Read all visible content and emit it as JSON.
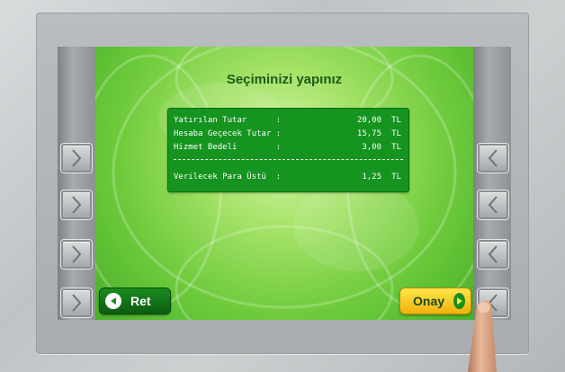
{
  "screen": {
    "title": "Seçiminizi yapınız",
    "summary": {
      "rows": [
        {
          "label": "Yatırılan Tutar      :",
          "value": "20,00",
          "currency": "TL"
        },
        {
          "label": "Hesaba Geçecek Tutar :",
          "value": "15,75",
          "currency": "TL"
        },
        {
          "label": "Hizmet Bedeli        :",
          "value": "3,00",
          "currency": "TL"
        }
      ],
      "total": {
        "label": "Verilecek Para Üstü  :",
        "value": "1,25",
        "currency": "TL"
      }
    },
    "buttons": {
      "back_label": "Ret",
      "confirm_label": "Onay"
    }
  },
  "icons": {
    "left_side_buttons": "chevron-right-icon",
    "right_side_buttons": "chevron-left-icon",
    "back": "arrow-left-circle-icon",
    "confirm": "arrow-right-circle-icon"
  },
  "colors": {
    "screen_green": "#6fcb3c",
    "info_box": "#15941f",
    "title_text": "#1c5b1c",
    "back_button": "#0d5d12",
    "confirm_button": "#f1b10c"
  }
}
